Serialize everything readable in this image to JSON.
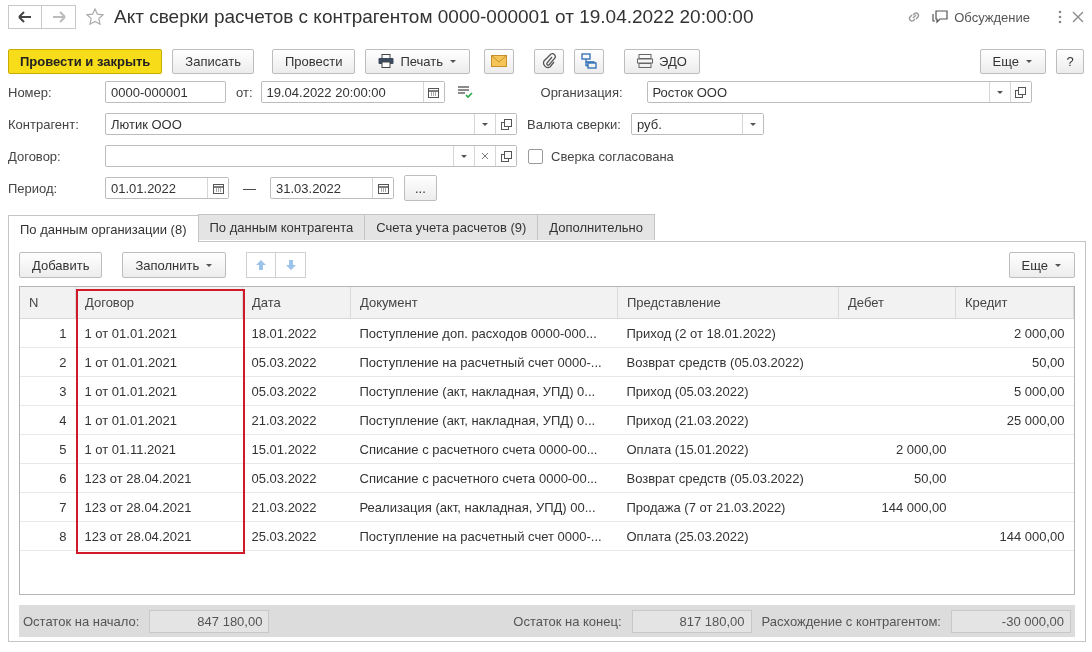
{
  "window": {
    "title": "Акт сверки расчетов с контрагентом 0000-000001 от 19.04.2022 20:00:00",
    "discussion": "Обсуждение"
  },
  "toolbar": [
    {
      "kind": "primary",
      "label": "Провести и закрыть"
    },
    {
      "kind": "text",
      "label": "Записать"
    },
    {
      "kind": "text",
      "label": "Провести"
    },
    {
      "kind": "print",
      "label": "Печать"
    },
    {
      "kind": "mail"
    },
    {
      "kind": "clip"
    },
    {
      "kind": "structure"
    },
    {
      "kind": "edo",
      "label": "ЭДО"
    }
  ],
  "toolbar_more": "Еще",
  "help": "?",
  "form": {
    "number_label": "Номер:",
    "number": "0000-000001",
    "date_label": "от:",
    "date": "19.04.2022 20:00:00",
    "org_label": "Организация:",
    "org": "Росток ООО",
    "counterparty_label": "Контрагент:",
    "counterparty": "Лютик ООО",
    "currency_label": "Валюта сверки:",
    "currency": "руб.",
    "contract_label": "Договор:",
    "agreed_label": "Сверка согласована",
    "agreed_checked": false,
    "period_label": "Период:",
    "period_from": "01.01.2022",
    "period_dash": "—",
    "period_to": "31.03.2022",
    "period_button": "..."
  },
  "tabs": [
    {
      "label": "По данным организации (8)",
      "selected": true
    },
    {
      "label": "По данным контрагента",
      "selected": false
    },
    {
      "label": "Счета учета расчетов (9)",
      "selected": false
    },
    {
      "label": "Дополнительно",
      "selected": false
    }
  ],
  "table_toolbar": {
    "add": "Добавить",
    "fill": "Заполнить",
    "more": "Еще"
  },
  "table": {
    "columns": [
      {
        "label": "N",
        "highlighted": false
      },
      {
        "label": "Договор",
        "highlighted": true
      },
      {
        "label": "Дата",
        "highlighted": false
      },
      {
        "label": "Документ",
        "highlighted": false
      },
      {
        "label": "Представление",
        "highlighted": false
      },
      {
        "label": "Дебет",
        "highlighted": false
      },
      {
        "label": "Кредит",
        "highlighted": false
      }
    ],
    "rows": [
      [
        "1",
        "1 от 01.01.2021",
        "18.01.2022",
        "Поступление доп. расходов 0000-000...",
        "Приход (2 от 18.01.2022)",
        "",
        "2 000,00"
      ],
      [
        "2",
        "1 от 01.01.2021",
        "05.03.2022",
        "Поступление на расчетный счет 0000-...",
        "Возврат средств (05.03.2022)",
        "",
        "50,00"
      ],
      [
        "3",
        "1 от 01.01.2021",
        "05.03.2022",
        "Поступление (акт, накладная, УПД) 0...",
        "Приход (05.03.2022)",
        "",
        "5 000,00"
      ],
      [
        "4",
        "1 от 01.01.2021",
        "21.03.2022",
        "Поступление (акт, накладная, УПД) 0...",
        "Приход (21.03.2022)",
        "",
        "25 000,00"
      ],
      [
        "5",
        "1 от 01.11.2021",
        "15.01.2022",
        "Списание с расчетного счета 0000-00...",
        "Оплата (15.01.2022)",
        "2 000,00",
        ""
      ],
      [
        "6",
        "123 от 28.04.2021",
        "05.03.2022",
        "Списание с расчетного счета 0000-00...",
        "Возврат средств (05.03.2022)",
        "50,00",
        ""
      ],
      [
        "7",
        "123 от 28.04.2021",
        "21.03.2022",
        "Реализация (акт, накладная, УПД) 00...",
        "Продажа (7 от 21.03.2022)",
        "144 000,00",
        ""
      ],
      [
        "8",
        "123 от 28.04.2021",
        "25.03.2022",
        "Поступление на расчетный счет 0000-...",
        "Оплата (25.03.2022)",
        "",
        "144 000,00"
      ]
    ]
  },
  "totals": [
    {
      "label": "Остаток на начало:",
      "value": "847 180,00"
    },
    {
      "label": "Остаток на конец:",
      "value": "817 180,00"
    },
    {
      "label": "Расхождение с контрагентом:",
      "value": "-30 000,00"
    }
  ]
}
